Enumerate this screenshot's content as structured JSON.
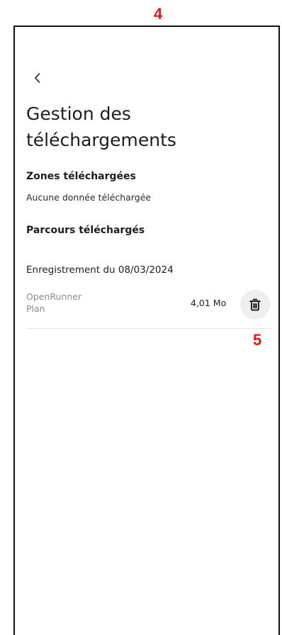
{
  "annotations": {
    "top": "4",
    "bottom": "5"
  },
  "header": {
    "title": "Gestion des téléchargements"
  },
  "zones": {
    "title": "Zones téléchargées",
    "empty_text": "Aucune donnée téléchargée"
  },
  "routes": {
    "title": "Parcours téléchargés",
    "record_title": "Enregistrement du 08/03/2024",
    "items": [
      {
        "name": "OpenRunner",
        "layer": "Plan",
        "size": "4,01 Mo"
      }
    ]
  },
  "icons": {
    "back": "chevron-left-icon",
    "delete": "trash-icon"
  }
}
